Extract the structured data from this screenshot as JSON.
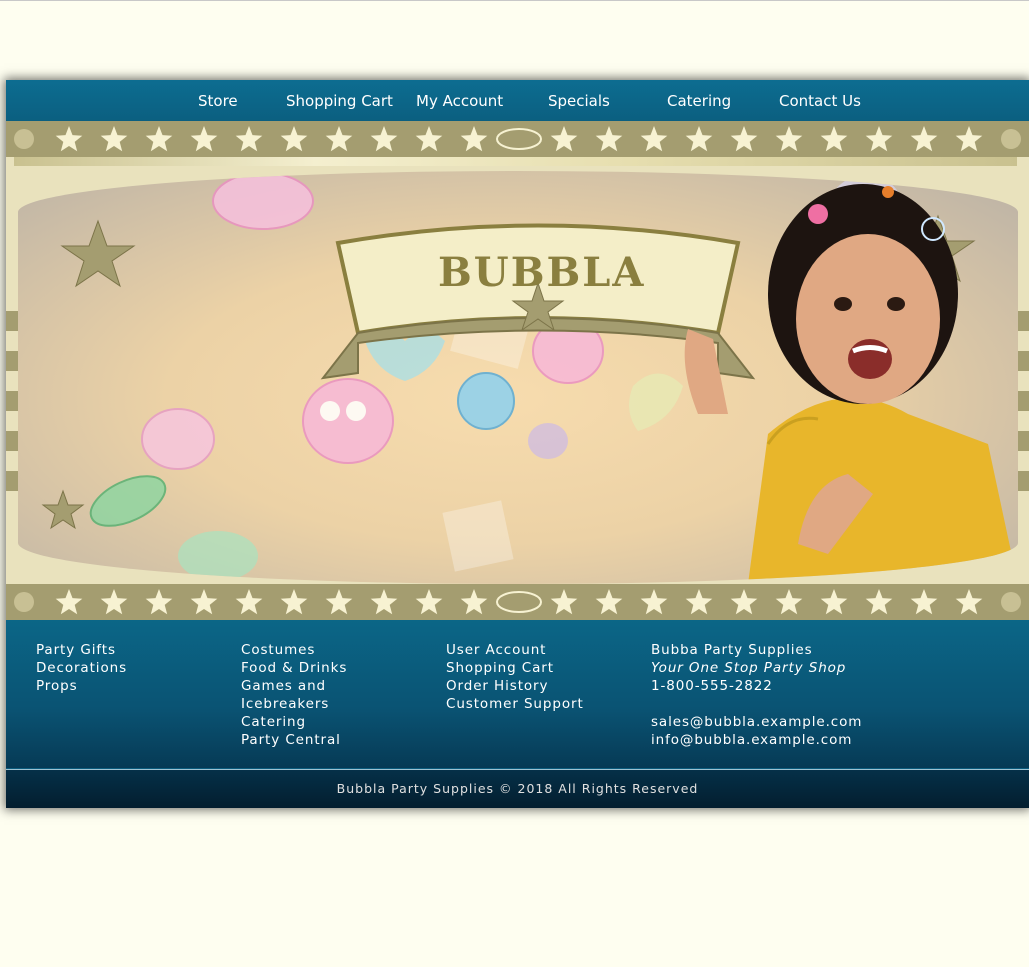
{
  "nav": {
    "items": [
      "Store",
      "Shopping Cart",
      "My Account",
      "Specials",
      "Catering",
      "Contact Us"
    ]
  },
  "banner": {
    "logo_text": "BUBBLA"
  },
  "footer": {
    "col1": [
      "Party Gifts",
      "Decorations",
      "Props"
    ],
    "col2": [
      "Costumes",
      "Food & Drinks",
      "Games and",
      "Icebreakers",
      "Catering",
      "Party Central"
    ],
    "col3": [
      "User Account",
      "Shopping Cart",
      "Order History",
      "Customer Support"
    ],
    "contact": {
      "company": "Bubba Party Supplies",
      "tagline": "Your One Stop Party Shop",
      "phone": "1-800-555-2822",
      "email_sales": "sales@bubbla.example.com",
      "email_info": "info@bubbla.example.com"
    },
    "copyright": "Bubbla Party Supplies © 2018 All Rights Reserved"
  },
  "colors": {
    "nav_bg": "#0d6d91",
    "footer_bg": "#0a5373",
    "page_bg": "#fefef0",
    "star_band": "#a49d70",
    "star": "#f7f2d2"
  }
}
